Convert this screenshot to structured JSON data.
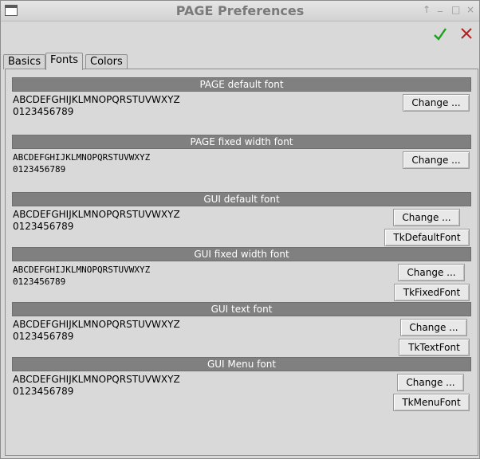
{
  "window": {
    "title": "PAGE Preferences",
    "controls": [
      "↑",
      "_",
      "□",
      "×"
    ]
  },
  "toolbar": {
    "ok_icon": "checkmark-icon",
    "cancel_icon": "x-icon",
    "ok_color": "#1e9e1e",
    "cancel_color": "#b22222"
  },
  "tabs": [
    {
      "label": "Basics",
      "active": false
    },
    {
      "label": "Fonts",
      "active": true
    },
    {
      "label": "Colors",
      "active": false
    }
  ],
  "sections": [
    {
      "header": "PAGE default font",
      "sample_line1": "ABCDEFGHIJKLMNOPQRSTUVWXYZ",
      "sample_line2": "0123456789",
      "change_label": "Change ...",
      "font_name": ""
    },
    {
      "header": "PAGE fixed width font",
      "sample_line1": "ABCDEFGHIJKLMNOPQRSTUVWXYZ",
      "sample_line2": "0123456789",
      "change_label": "Change ...",
      "font_name": ""
    },
    {
      "header": "GUI default font",
      "sample_line1": "ABCDEFGHIJKLMNOPQRSTUVWXYZ",
      "sample_line2": "0123456789",
      "change_label": "Change ...",
      "font_name": "TkDefaultFont"
    },
    {
      "header": "GUI fixed width font",
      "sample_line1": "ABCDEFGHIJKLMNOPQRSTUVWXYZ",
      "sample_line2": "0123456789",
      "change_label": "Change ...",
      "font_name": "TkFixedFont"
    },
    {
      "header": "GUI text font",
      "sample_line1": "ABCDEFGHIJKLMNOPQRSTUVWXYZ",
      "sample_line2": "0123456789",
      "change_label": "Change ...",
      "font_name": "TkTextFont"
    },
    {
      "header": "GUI Menu font",
      "sample_line1": "ABCDEFGHIJKLMNOPQRSTUVWXYZ",
      "sample_line2": "0123456789",
      "change_label": "Change ...",
      "font_name": "TkMenuFont"
    }
  ]
}
